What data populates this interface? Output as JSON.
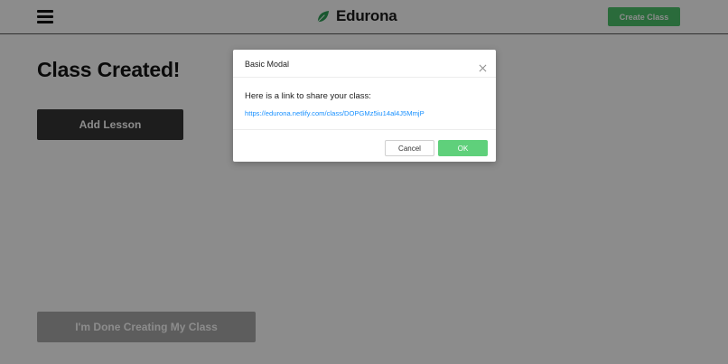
{
  "header": {
    "brand_name": "Edurona",
    "brand_icon": "leaf-icon",
    "menu_icon": "hamburger-menu-icon",
    "create_class_label": "Create Class"
  },
  "main": {
    "title": "Class Created!",
    "add_lesson_label": "Add Lesson",
    "done_label": "I'm Done Creating My Class"
  },
  "modal": {
    "title": "Basic Modal",
    "message": "Here is a link to share your class:",
    "link": "https://edurona.netlify.com/class/DOPGMz5iu14al4J5MmjP",
    "close_icon": "close-icon",
    "cancel_label": "Cancel",
    "ok_label": "OK"
  },
  "colors": {
    "brand_green": "#4ec46c",
    "ok_green": "#5fd07b",
    "link_blue": "#1890ff",
    "dark_button": "#353535",
    "disabled_button": "#a9a9a9"
  }
}
